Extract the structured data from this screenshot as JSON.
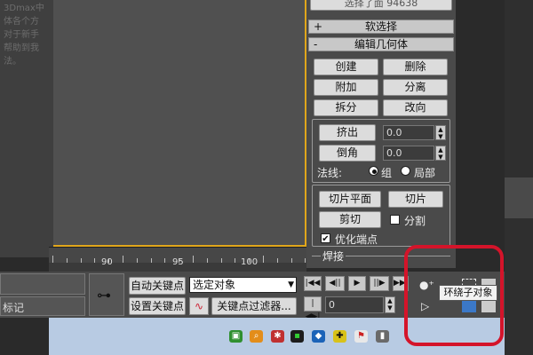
{
  "article": {
    "lines": [
      "3Dmax中",
      "体各个方",
      "对于新手",
      "帮助到我",
      "法。"
    ]
  },
  "command_panel": {
    "top_partial": "选择了面 94638",
    "soft_selection": {
      "sign": "+",
      "label": "软选择"
    },
    "edit_geometry": {
      "sign": "-",
      "label": "编辑几何体"
    },
    "buttons": {
      "create": "创建",
      "delete": "删除",
      "attach": "附加",
      "detach": "分离",
      "split": "拆分",
      "flip": "改向",
      "extrude": "挤出",
      "bevel": "倒角",
      "slice_plane": "切片平面",
      "slice": "切片",
      "cut": "剪切"
    },
    "extrude_value": "0.0",
    "bevel_value": "0.0",
    "normals_label": "法线:",
    "normals_group": "组",
    "normals_local": "局部",
    "normals_selected": "group",
    "split_label": "分割",
    "split_checked": false,
    "optimize_label": "优化端点",
    "optimize_checked": true,
    "weld_label": "焊接"
  },
  "timeline": {
    "ticks": [
      "90",
      "95",
      "100"
    ]
  },
  "status": {
    "left_label": "标记",
    "auto_key": "自动关键点",
    "set_key": "设置关键点",
    "selection_dropdown": "选定对象",
    "key_filters": "关键点过滤器...",
    "frame_value": "0"
  },
  "tooltip": "环绕子对象",
  "colors": {
    "viewport_border": "#e0a61b",
    "highlight": "#d4142a",
    "taskbar": "#b8cbe3"
  }
}
